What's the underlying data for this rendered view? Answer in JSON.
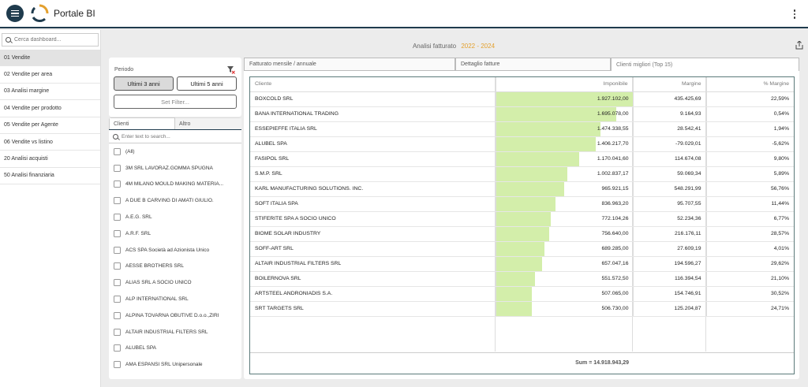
{
  "app": {
    "title": "Portale BI"
  },
  "sidebar": {
    "search_placeholder": "Cerca dashboard...",
    "items": [
      {
        "label": "01 Vendite"
      },
      {
        "label": "02 Vendite per area"
      },
      {
        "label": "03 Analisi margine"
      },
      {
        "label": "04 Vendite per prodotto"
      },
      {
        "label": "05 Vendite per Agente"
      },
      {
        "label": "06 Vendite vs listino"
      },
      {
        "label": "20 Analisi acquisti"
      },
      {
        "label": "50 Analisi finanziaria"
      }
    ]
  },
  "report": {
    "title": "Analisi fatturato",
    "period": "2022 - 2024"
  },
  "filters": {
    "label": "Periodo",
    "btn_3": "Ultimi 3 anni",
    "btn_5": "Ultimi 5 anni",
    "set_filter": "Set Filter..."
  },
  "clienti": {
    "tab_clienti": "Clienti",
    "tab_altro": "Altro",
    "search_placeholder": "Enter text to search...",
    "items": [
      "(All)",
      "3M SRL LAVORAZ.GOMMA SPUGNA",
      "4M MILANO MOULD MAKING MATERIA...",
      "A DUE B CARVING DI AMATI GIULIO.",
      "A.E.G. SRL",
      "A.R.F. SRL",
      "ACS SPA Società ad Azionista Unico",
      "AESSE BROTHERS SRL",
      "ALIAS SRL A SOCIO UNICO",
      "ALP INTERNATIONAL SRL",
      "ALPINA TOVARNA OBUTIVE D.o.o.,ZIRI",
      "ALTAIR INDUSTRIAL FILTERS SRL",
      "ALUBEL SPA",
      "AMA ESPANSI SRL Unipersonale"
    ]
  },
  "main_tabs": {
    "t1": "Fatturato mensile / annuale",
    "t2": "Dettaglio fatture",
    "t3": "Clienti migliori (Top 15)"
  },
  "grid": {
    "headers": {
      "cliente": "Cliente",
      "imponibile": "Imponibile",
      "margine": "Margine",
      "pct": "% Margine"
    },
    "max_value": 1927102.0,
    "rows": [
      {
        "cliente": "BOXCOLD SRL",
        "imponibile": "1.927.102,00",
        "value": 1927102.0,
        "margine": "435.425,69",
        "pct": "22,59%"
      },
      {
        "cliente": "BANA INTERNATIONAL TRADING",
        "imponibile": "1.695.078,00",
        "value": 1695078.0,
        "margine": "9.164,93",
        "pct": "0,54%"
      },
      {
        "cliente": "ESSEPIEFFE ITALIA SRL",
        "imponibile": "1.474.338,55",
        "value": 1474338.55,
        "margine": "28.542,41",
        "pct": "1,94%"
      },
      {
        "cliente": "ALUBEL SPA",
        "imponibile": "1.406.217,70",
        "value": 1406217.7,
        "margine": "-79.029,01",
        "pct": "-5,62%"
      },
      {
        "cliente": "FASIPOL SRL",
        "imponibile": "1.170.041,60",
        "value": 1170041.6,
        "margine": "114.674,08",
        "pct": "9,80%"
      },
      {
        "cliente": "S.M.P. SRL",
        "imponibile": "1.002.837,17",
        "value": 1002837.17,
        "margine": "59.069,34",
        "pct": "5,89%"
      },
      {
        "cliente": "KARL MANUFACTURING SOLUTIONS. INC.",
        "imponibile": "965.921,15",
        "value": 965921.15,
        "margine": "548.291,99",
        "pct": "56,76%"
      },
      {
        "cliente": "SOFT ITALIA SPA",
        "imponibile": "836.963,20",
        "value": 836963.2,
        "margine": "95.707,55",
        "pct": "11,44%"
      },
      {
        "cliente": "STIFERITE SPA A SOCIO UNICO",
        "imponibile": "772.104,26",
        "value": 772104.26,
        "margine": "52.234,36",
        "pct": "6,77%"
      },
      {
        "cliente": "BIOME SOLAR INDUSTRY",
        "imponibile": "756.640,00",
        "value": 756640.0,
        "margine": "216.176,11",
        "pct": "28,57%"
      },
      {
        "cliente": "SOFF-ART SRL",
        "imponibile": "689.285,00",
        "value": 689285.0,
        "margine": "27.609,19",
        "pct": "4,01%"
      },
      {
        "cliente": "ALTAIR INDUSTRIAL FILTERS SRL",
        "imponibile": "657.047,16",
        "value": 657047.16,
        "margine": "194.596,27",
        "pct": "29,62%"
      },
      {
        "cliente": "BOILERNOVA SRL",
        "imponibile": "551.572,50",
        "value": 551572.5,
        "margine": "116.394,54",
        "pct": "21,10%"
      },
      {
        "cliente": "ARTSTEEL ANDRONIADIS S.A.",
        "imponibile": "507.065,00",
        "value": 507065.0,
        "margine": "154.746,91",
        "pct": "30,52%"
      },
      {
        "cliente": "SRT TARGETS SRL",
        "imponibile": "506.730,00",
        "value": 506730.0,
        "margine": "125.204,87",
        "pct": "24,71%"
      }
    ],
    "sum_label": "Sum = 14.918.943,29"
  },
  "colors": {
    "accent": "#e3a02e",
    "navy": "#1f3b4d",
    "bar": "#d3eeaa"
  }
}
